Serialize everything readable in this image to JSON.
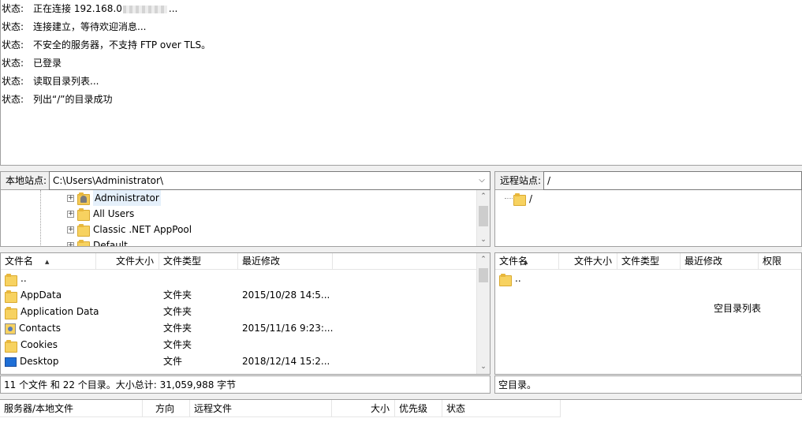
{
  "message_log": [
    {
      "label": "状态:",
      "text": "正在连接 192.168.0",
      "masked": true,
      "suffix": "..."
    },
    {
      "label": "状态:",
      "text": "连接建立，等待欢迎消息..."
    },
    {
      "label": "状态:",
      "text": "不安全的服务器，不支持 FTP over TLS。"
    },
    {
      "label": "状态:",
      "text": "已登录"
    },
    {
      "label": "状态:",
      "text": "读取目录列表..."
    },
    {
      "label": "状态:",
      "text": "列出“/”的目录成功"
    }
  ],
  "local": {
    "site_label": "本地站点:",
    "site_path": "C:\\Users\\Administrator\\",
    "tree": [
      {
        "label": "Administrator",
        "icon": "user-folder-icon",
        "selected": true
      },
      {
        "label": "All Users",
        "icon": "folder-icon"
      },
      {
        "label": "Classic .NET AppPool",
        "icon": "folder-icon"
      },
      {
        "label": "Default",
        "icon": "folder-icon"
      }
    ],
    "columns": [
      "文件名",
      "文件大小",
      "文件类型",
      "最近修改"
    ],
    "files": [
      {
        "name": "..",
        "size": "",
        "type": "",
        "modified": "",
        "icon": "folder-icon"
      },
      {
        "name": "AppData",
        "size": "",
        "type": "文件夹",
        "modified": "2015/10/28 14:5...",
        "icon": "folder-icon"
      },
      {
        "name": "Application Data",
        "size": "",
        "type": "文件夹",
        "modified": "",
        "icon": "folder-icon"
      },
      {
        "name": "Contacts",
        "size": "",
        "type": "文件夹",
        "modified": "2015/11/16 9:23:...",
        "icon": "contacts-icon"
      },
      {
        "name": "Cookies",
        "size": "",
        "type": "文件夹",
        "modified": "",
        "icon": "folder-icon"
      },
      {
        "name": "Desktop",
        "size": "",
        "type": "文件",
        "modified": "2018/12/14 15:2...",
        "icon": "desktop-icon"
      }
    ],
    "status": "11 个文件 和 22 个目录。大小总计: 31,059,988 字节"
  },
  "remote": {
    "site_label": "远程站点:",
    "site_path": "/",
    "tree": [
      {
        "label": "/",
        "icon": "folder-icon"
      }
    ],
    "columns": [
      "文件名",
      "文件大小",
      "文件类型",
      "最近修改",
      "权限"
    ],
    "files": [
      {
        "name": "..",
        "icon": "folder-icon"
      }
    ],
    "empty_message": "空目录列表",
    "status": "空目录。"
  },
  "queue": {
    "columns": [
      "服务器/本地文件",
      "方向",
      "远程文件",
      "大小",
      "优先级",
      "状态"
    ]
  }
}
